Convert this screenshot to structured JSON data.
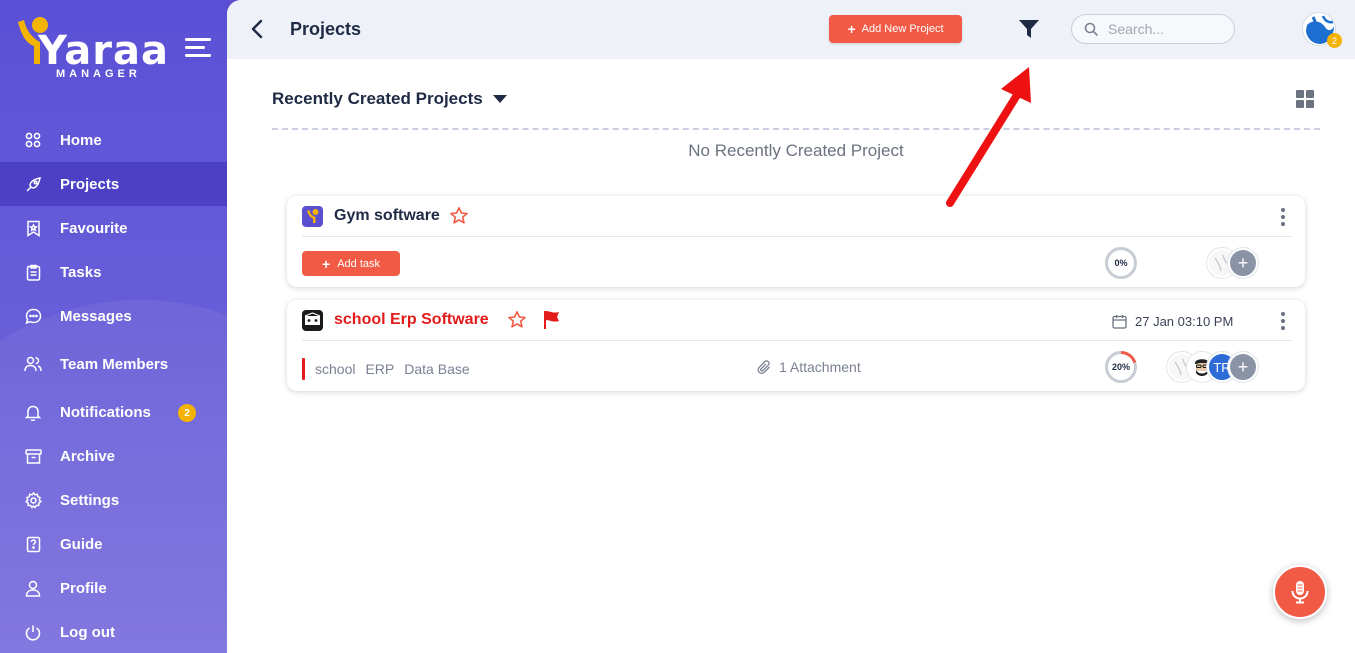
{
  "brand": {
    "wordmark": "Yaraa",
    "subtitle": "MANAGER"
  },
  "sidebar": {
    "items": [
      {
        "label": "Home",
        "icon": "grid-icon"
      },
      {
        "label": "Projects",
        "icon": "rocket-icon",
        "active": true
      },
      {
        "label": "Favourite",
        "icon": "bookmark-icon"
      },
      {
        "label": "Tasks",
        "icon": "clipboard-icon"
      },
      {
        "label": "Messages",
        "icon": "chat-icon"
      },
      {
        "label": "Team Members",
        "icon": "users-icon"
      },
      {
        "label": "Notifications",
        "icon": "bell-icon",
        "badge": "2"
      },
      {
        "label": "Archive",
        "icon": "archive-icon"
      },
      {
        "label": "Settings",
        "icon": "gear-icon"
      },
      {
        "label": "Guide",
        "icon": "help-icon"
      },
      {
        "label": "Profile",
        "icon": "user-icon"
      },
      {
        "label": "Log out",
        "icon": "power-icon"
      }
    ]
  },
  "header": {
    "title": "Projects",
    "add_project_label": "Add New Project",
    "search_placeholder": "Search...",
    "user_badge": "2"
  },
  "section": {
    "title": "Recently Created Projects",
    "empty_text": "No Recently Created Project"
  },
  "projects": [
    {
      "name": "Gym software",
      "name_color": "#1f2a44",
      "add_task_label": "Add task",
      "progress": "0%",
      "progress_value": 0
    },
    {
      "name": "school Erp Software",
      "name_color": "#e31b1b",
      "date": "27 Jan 03:10 PM",
      "tags": [
        "school",
        "ERP",
        "Data Base"
      ],
      "attachment": "1 Attachment",
      "progress": "20%",
      "progress_value": 20,
      "member_initials": "TR"
    }
  ],
  "colors": {
    "accent": "#f15a44",
    "sidebar": "#5a50d6",
    "badge": "#f5b301",
    "flag": "#e31b1b",
    "annotation_arrow": "#ee1111"
  }
}
